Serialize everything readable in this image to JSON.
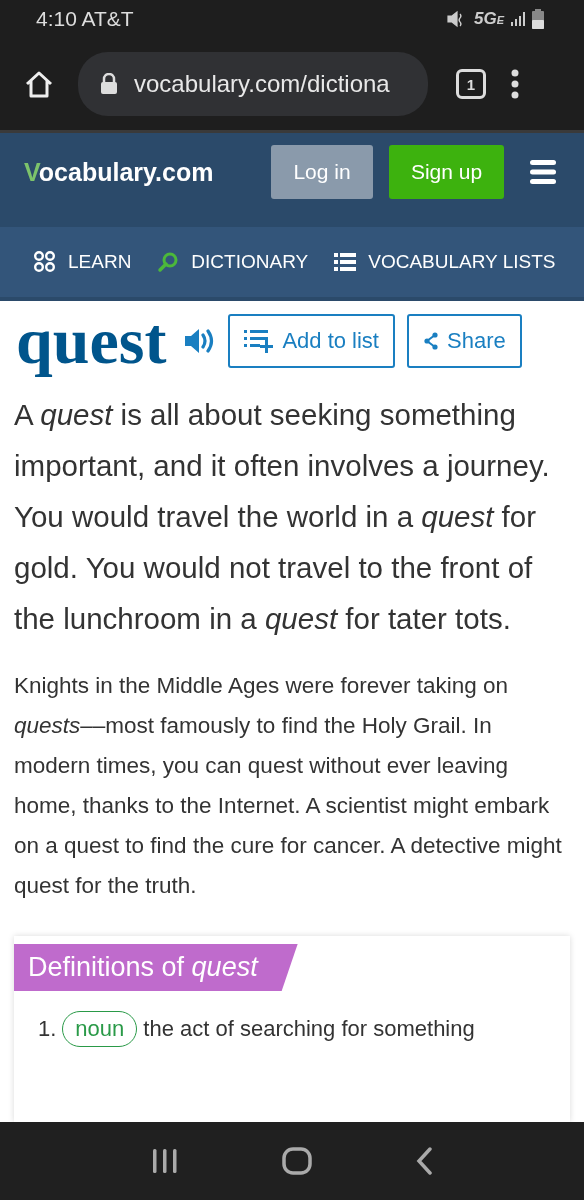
{
  "status_bar": {
    "time_carrier": "4:10 AT&T",
    "network": "5G",
    "network_sub": "E"
  },
  "browser": {
    "url": "vocabulary.com/dictiona",
    "tab_count": "1"
  },
  "header": {
    "logo_mark": "V",
    "logo_text": "ocabulary.com",
    "login": "Log in",
    "signup": "Sign up"
  },
  "nav": [
    {
      "kind": "learn",
      "label": "LEARN"
    },
    {
      "kind": "dictionary",
      "label": "DICTIONARY"
    },
    {
      "kind": "lists",
      "label": "VOCABULARY LISTS"
    }
  ],
  "word": {
    "title": "quest",
    "add_to_list": "Add to list",
    "share": "Share"
  },
  "short_definition": "A *quest* is all about seeking something important, and it often involves a journey. You would travel the world in a *quest* for gold. You would not travel to the front of the lunchroom in a *quest* for tater tots.",
  "long_definition": "Knights in the Middle Ages were forever taking on *quests*––most famously to find the Holy Grail. In modern times, you can quest without ever leaving home, thanks to the Internet. A scientist might embark on a quest to find the cure for cancer. A detective might quest for the truth.",
  "definitions": {
    "heading": "Definitions of *quest*",
    "items": [
      {
        "number": "1.",
        "pos": "noun",
        "text": "the act of searching for something"
      }
    ]
  }
}
